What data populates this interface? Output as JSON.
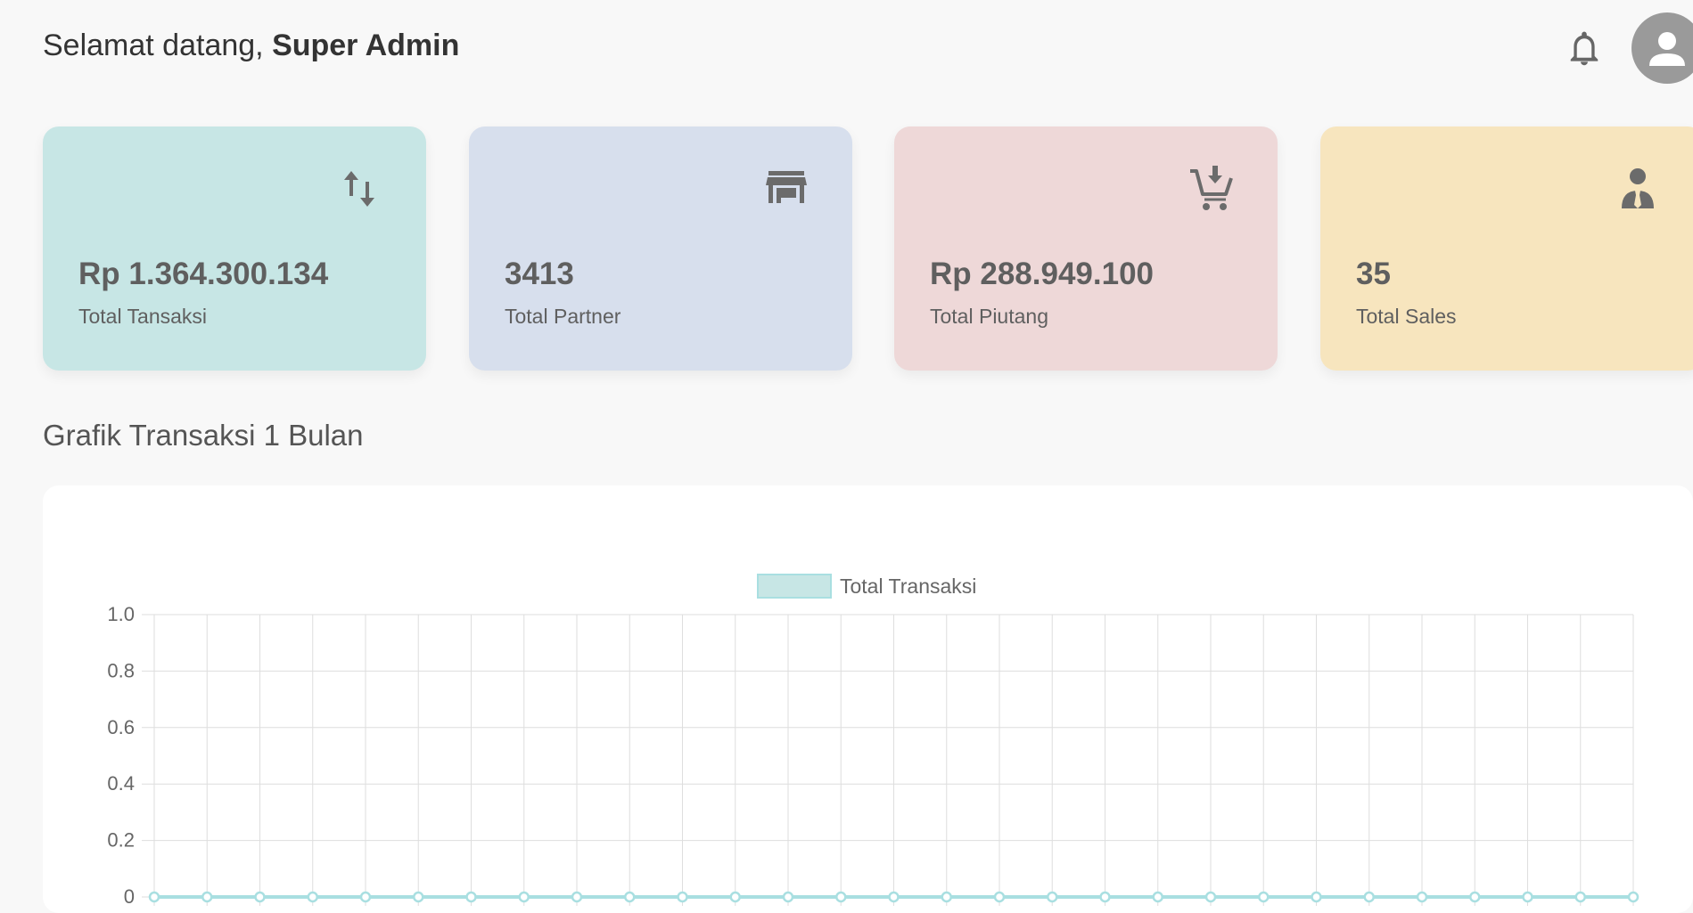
{
  "header": {
    "greeting_prefix": "Selamat datang, ",
    "user_name": "Super Admin",
    "icons": {
      "notification": "bell-icon",
      "profile": "user-avatar-icon"
    }
  },
  "cards": [
    {
      "value": "Rp 1.364.300.134",
      "label": "Total Tansaksi",
      "icon": "swap-vertical-icon",
      "color": "#c7e6e5"
    },
    {
      "value": "3413",
      "label": "Total Partner",
      "icon": "store-icon",
      "color": "#d7dfed"
    },
    {
      "value": "Rp 288.949.100",
      "label": "Total Piutang",
      "icon": "cart-download-icon",
      "color": "#eed8d8"
    },
    {
      "value": "35",
      "label": "Total Sales",
      "icon": "person-tie-icon",
      "color": "#f7e5be"
    }
  ],
  "section": {
    "title": "Grafik Transaksi 1 Bulan"
  },
  "chart_data": {
    "type": "line",
    "legend": [
      "Total Transaksi"
    ],
    "legend_position": "top-center",
    "grid": true,
    "ylim": [
      0,
      1.0
    ],
    "y_ticks": [
      "0",
      "0.2",
      "0.4",
      "0.6",
      "0.8",
      "1.0"
    ],
    "series": [
      {
        "name": "Total Transaksi",
        "color": "#a9dfe1",
        "fill": "#c7e6e5",
        "values": [
          0,
          0,
          0,
          0,
          0,
          0,
          0,
          0,
          0,
          0,
          0,
          0,
          0,
          0,
          0,
          0,
          0,
          0,
          0,
          0,
          0,
          0,
          0,
          0,
          0,
          0,
          0,
          0,
          0
        ]
      }
    ]
  }
}
